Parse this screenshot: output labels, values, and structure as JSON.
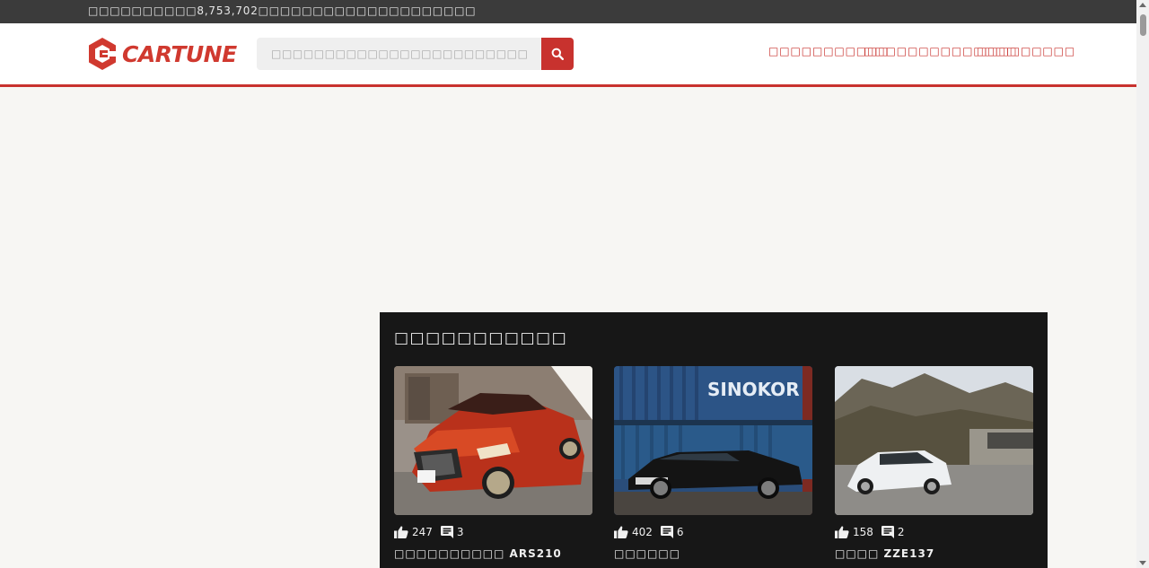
{
  "topbar": {
    "text": "□□□□□□□□□□8,753,702□□□□□□□□□□□□□□□□□□□□"
  },
  "header": {
    "logo_text": "CARTUNE",
    "search": {
      "placeholder": "□□□□□□□□□□□□□□□□□□□□□□□□",
      "value": ""
    },
    "nav": [
      "□□□□□□□□□□□",
      "□□□□□□□□□□□□□□",
      "□□□□□□□□□"
    ]
  },
  "panel": {
    "title": "□□□□□□□□□□□",
    "cards": [
      {
        "likes": "247",
        "comments": "3",
        "title": "□□□□□□□□□□ ARS210",
        "image": "red-sedan-photo"
      },
      {
        "likes": "402",
        "comments": "6",
        "title": "□□□□□□",
        "image": "black-sedan-containers-photo"
      },
      {
        "likes": "158",
        "comments": "2",
        "title": "□□□□ ZZE137",
        "image": "white-hatchback-mountains-photo"
      }
    ]
  },
  "icons": {
    "search": "search-icon",
    "like": "thumbs-up-icon",
    "comment": "comment-icon"
  },
  "colors": {
    "brand": "#c8322e",
    "topbar": "#3b3b3b",
    "panel": "#171717",
    "background": "#f7f6f3"
  }
}
